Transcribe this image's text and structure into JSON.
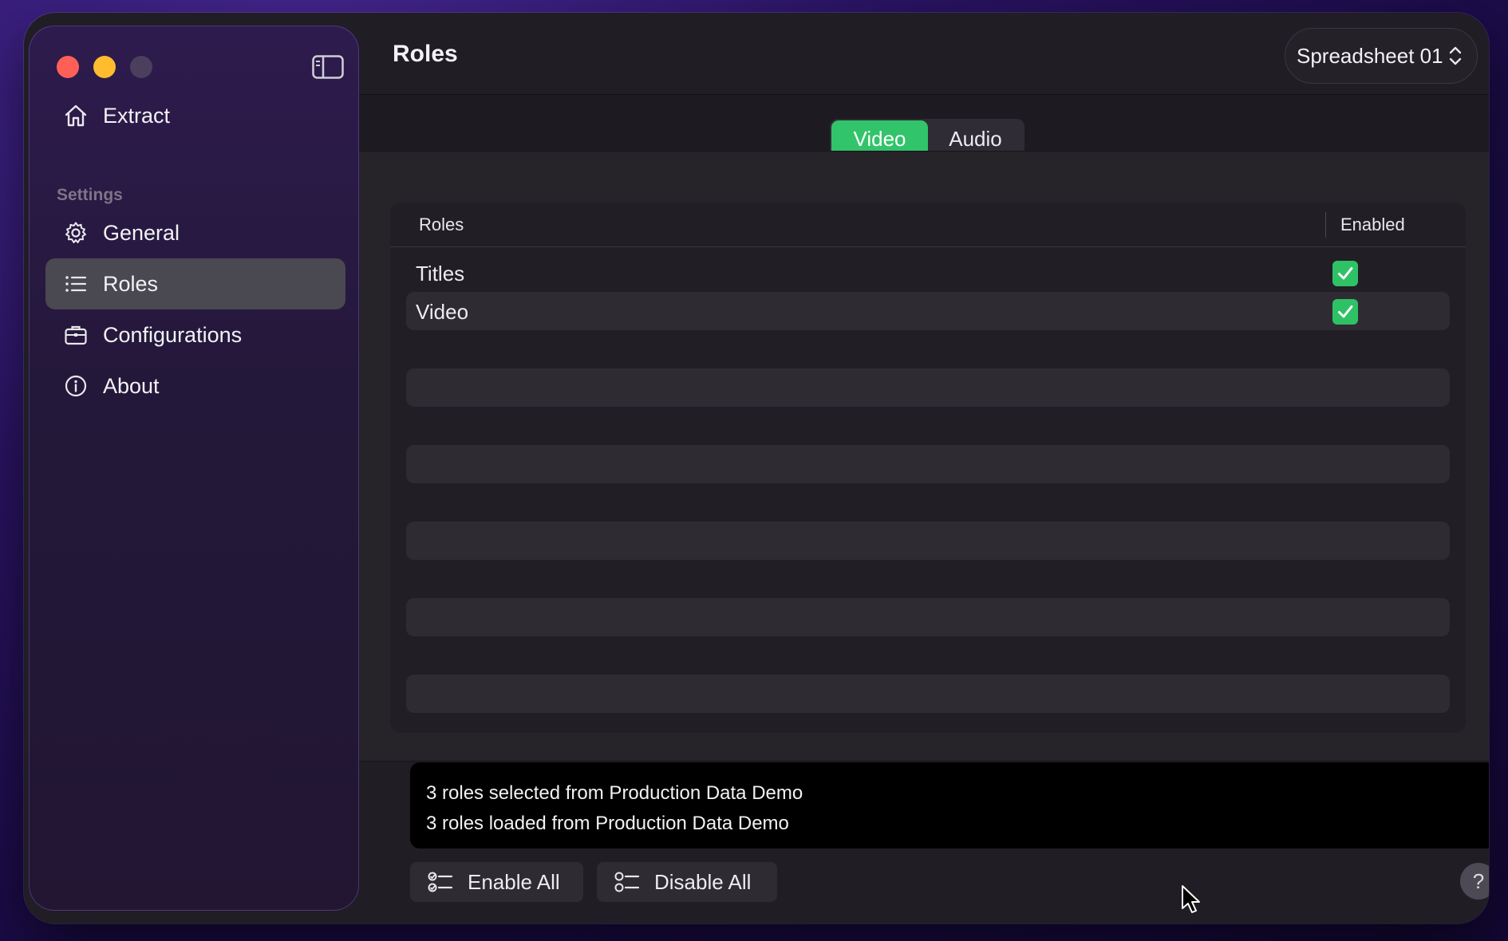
{
  "window": {
    "traffic_lights": [
      "close",
      "minimize",
      "zoom"
    ]
  },
  "sidebar": {
    "toggle_icon": "sidebar-left-icon",
    "primary_items": [
      {
        "label": "Extract",
        "icon": "house-icon"
      }
    ],
    "section_label": "Settings",
    "items": [
      {
        "label": "General",
        "icon": "gear-icon",
        "active": false
      },
      {
        "label": "Roles",
        "icon": "list-icon",
        "active": true
      },
      {
        "label": "Configurations",
        "icon": "briefcase-icon",
        "active": false
      },
      {
        "label": "About",
        "icon": "info-circle-icon",
        "active": false
      }
    ]
  },
  "header": {
    "title": "Roles",
    "document_picker": "Spreadsheet 01"
  },
  "tabs": [
    {
      "label": "Video",
      "active": true
    },
    {
      "label": "Audio",
      "active": false
    }
  ],
  "table": {
    "columns": [
      "Roles",
      "Enabled"
    ],
    "rows": [
      {
        "name": "Titles",
        "enabled": true
      },
      {
        "name": "Video",
        "enabled": true
      }
    ]
  },
  "log": {
    "lines": [
      "3 roles selected from Production Data Demo",
      "3 roles loaded from Production Data Demo"
    ]
  },
  "footer": {
    "enable_all_label": "Enable All",
    "disable_all_label": "Disable All",
    "help_label": "?"
  },
  "colors": {
    "accent": "#31c46a",
    "close": "#fe5f57",
    "minimize": "#febc2e",
    "sidebar_bg": "#2e1b4e"
  }
}
